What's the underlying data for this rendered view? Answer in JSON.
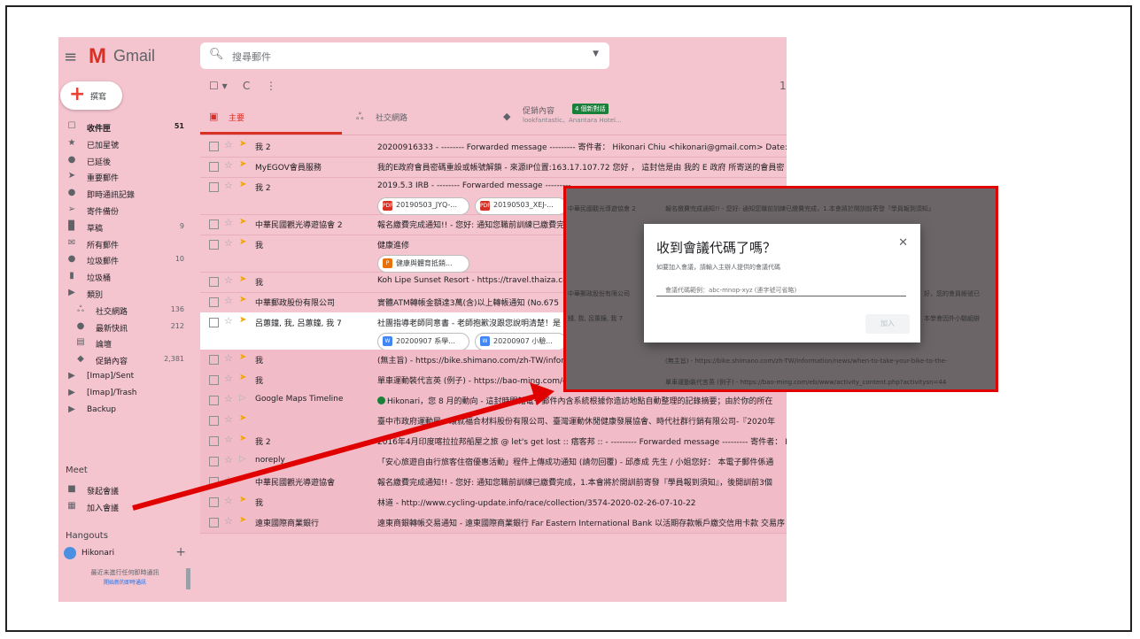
{
  "header": {
    "app_name": "Gmail",
    "search_placeholder": "搜尋郵件"
  },
  "sidebar": {
    "compose_label": "撰寫",
    "items": [
      {
        "label": "收件匣",
        "count": "51",
        "icon": "inbox-icon",
        "glyph": "☐"
      },
      {
        "label": "已加星號",
        "count": "",
        "icon": "star-icon",
        "glyph": "★"
      },
      {
        "label": "已延後",
        "count": "",
        "icon": "snooze-clock-icon",
        "glyph": "●"
      },
      {
        "label": "重要郵件",
        "count": "",
        "icon": "important-icon",
        "glyph": "➤"
      },
      {
        "label": "即時通訊記錄",
        "count": "",
        "icon": "chat-icon",
        "glyph": "●"
      },
      {
        "label": "寄件備份",
        "count": "",
        "icon": "send-icon",
        "glyph": "➢"
      },
      {
        "label": "草稿",
        "count": "9",
        "icon": "draft-icon",
        "glyph": "▉"
      },
      {
        "label": "所有郵件",
        "count": "",
        "icon": "all-mail-icon",
        "glyph": "✉"
      },
      {
        "label": "垃圾郵件",
        "count": "10",
        "icon": "spam-icon",
        "glyph": "●"
      },
      {
        "label": "垃圾桶",
        "count": "",
        "icon": "trash-icon",
        "glyph": "▮"
      },
      {
        "label": "類別",
        "count": "",
        "icon": "label-icon",
        "glyph": "▶"
      }
    ],
    "categories": [
      {
        "label": "社交網路",
        "count": "136",
        "icon": "people-icon",
        "glyph": "ஃ"
      },
      {
        "label": "最新快訊",
        "count": "212",
        "icon": "info-icon",
        "glyph": "●"
      },
      {
        "label": "論壇",
        "count": "",
        "icon": "forum-icon",
        "glyph": "▤"
      },
      {
        "label": "促銷內容",
        "count": "2,381",
        "icon": "tag-icon",
        "glyph": "◆"
      }
    ],
    "labels": [
      {
        "label": "[Imap]/Sent",
        "icon": "label-icon",
        "glyph": "▶"
      },
      {
        "label": "[Imap]/Trash",
        "icon": "label-icon",
        "glyph": "▶"
      },
      {
        "label": "Backup",
        "icon": "label-icon",
        "glyph": "▶"
      }
    ],
    "meet_heading": "Meet",
    "meet_items": [
      {
        "label": "發起會議",
        "icon": "video-icon",
        "glyph": "■"
      },
      {
        "label": "加入會議",
        "icon": "keyboard-icon",
        "glyph": "▦"
      }
    ],
    "hangouts_heading": "Hangouts",
    "hangouts_user": "Hikonari",
    "hangouts_note": "最近未進行任何即時通訊",
    "hangouts_link": "開始新的即時通訊"
  },
  "toolbar": {
    "select": "☐ ▾",
    "refresh": "C",
    "more": "⋮",
    "page": "1"
  },
  "tabs": {
    "primary": "主要",
    "social": "社交網路",
    "promotions": "促銷內容",
    "promo_badge": "4 個新對話",
    "promo_sub": "lookfantastic、Anantara Hotel..."
  },
  "emails": [
    {
      "sender": "我 2",
      "subject": "20200916333 - -------- Forwarded message --------- 寄件者： Hikonari Chiu <hikonari@gmail.com> Date: 2020年",
      "important": true
    },
    {
      "sender": "MyEGOV會員服務",
      "subject": "我的E政府會員密碼重設或帳號解鎖 - 來源IP位置:163.17.107.72 您好 ， 這封信是由 我的 E 政府 所寄送的會員密",
      "important": true
    },
    {
      "sender": "我 2",
      "subject": "2019.5.3 IRB - -------- Forwarded message ---------",
      "important": true,
      "attachments": [
        {
          "type": "PDF",
          "name": "20190503_JYQ-..."
        },
        {
          "type": "PDF",
          "name": "20190503_XEJ-..."
        }
      ]
    },
    {
      "sender": "中華民國觀光導遊協會 2",
      "subject": "報名繳費完成通知!! - 您好: 通知您職前訓練已繳費完成",
      "important": true
    },
    {
      "sender": "我",
      "subject": "健康進修",
      "important": true,
      "attachments": [
        {
          "type": "P",
          "name": "健康與體育抵銷..."
        }
      ]
    },
    {
      "sender": "我",
      "subject": "Koh Lipe Sunset Resort - https://travel.thaiza.com",
      "important": true
    },
    {
      "sender": "中華郵政股份有限公司",
      "subject": "實體ATM轉帳金額達3萬(含)以上轉帳通知 (No.675",
      "important": true
    },
    {
      "sender": "呂蕙鐘, 我, 呂蕙鐘, 我 7",
      "subject": "社團指導老師同意書 - 老師抱歉沒跟您說明清楚！是",
      "important": true,
      "attachments": [
        {
          "type": "W",
          "name": "20200907 系學..."
        },
        {
          "type": "W",
          "name": "20200907 小驗..."
        }
      ]
    },
    {
      "sender": "我",
      "subject": "(無主旨) - https://bike.shimano.com/zh-TW/information/news/when-to-take-your-bike-to-the-shop--six-reason",
      "important": true
    },
    {
      "sender": "我",
      "subject": "單車運動裝代言英 (例子) - https://bao-ming.com/eb/www/activity_content.php?activitysn=4457&gclid=Cj0KC",
      "important": true
    },
    {
      "sender": "Google Maps Timeline",
      "subject": "Hikonari，您 8 月的動向 - 這封時間軸電子郵件內含系統根據你造訪地點自動整理的記錄摘要；由於你的所在",
      "important": false,
      "maps": true
    },
    {
      "sender": "",
      "subject": "臺中市政府運動局、環就福合材料股份有限公司、臺灣運動休閒健康發展協會、時代社群行銷有限公司-『2020年",
      "important": true
    },
    {
      "sender": "我 2",
      "subject": "2016年4月印度喀拉拉邦船屋之旅 @ let's get lost :: 痞客邦 :: - --------- Forwarded message --------- 寄件者： Hiko",
      "important": true
    },
    {
      "sender": "noreply",
      "subject": "「安心旅遊自由行旅客住宿優惠活動」程件上傳成功通知 (請勿回覆) - 邱彥成 先生 / 小姐您好： 本電子郵件係通",
      "important": false
    },
    {
      "sender": "中華民國觀光導遊協會",
      "subject": "報名繳費完成通知!! - 您好: 通知您職前訓練已繳費完成，1.本會將於開訓前寄發『學員報到須知』，後開訓前3個",
      "important": true
    },
    {
      "sender": "我",
      "subject": "林道 - http://www.cycling-update.info/race/collection/3574-2020-02-26-07-10-22",
      "important": true
    },
    {
      "sender": "遠東國際商業銀行",
      "subject": "遠東商銀轉帳交易通知 - 遠東國際商業銀行 Far Eastern International Bank 以活期存款帳戶繳交信用卡款 交易序",
      "important": true
    }
  ],
  "callout": {
    "bg_rows": [
      "中華民國觀光導遊協會 2",
      "報名繳費完成通知!! - 您好: 通知您職前訓練已繳費完成，1.本會將於開訓前寄發『學員報到須知』",
      "中華郵政股份有限公司",
      "好，您的會員帳號已",
      "錢, 我, 呂蕙鐘, 我 7",
      "本學會因外小驗組辦",
      "(無主旨) - https://bike.shimano.com/zh-TW/information/news/when-to-take-your-bike-to-the-",
      "單車運動裝代言英 (例子) - https://bao-ming.com/eb/www/activity_content.php?activitysn=44"
    ],
    "dialog_title": "收到會議代碼了嗎？",
    "dialog_desc": "如要加入會議，請輸入主辦人提供的會議代碼",
    "input_placeholder": "會議代碼範例：abc-mnop-xyz (連字號可省略)",
    "join_label": "加入"
  },
  "colors": {
    "gmail_bg": "#f4c4cf",
    "gmail_red": "#d93025",
    "callout_border": "#e10000",
    "arrow": "#e10000",
    "important": "#f2a600"
  }
}
